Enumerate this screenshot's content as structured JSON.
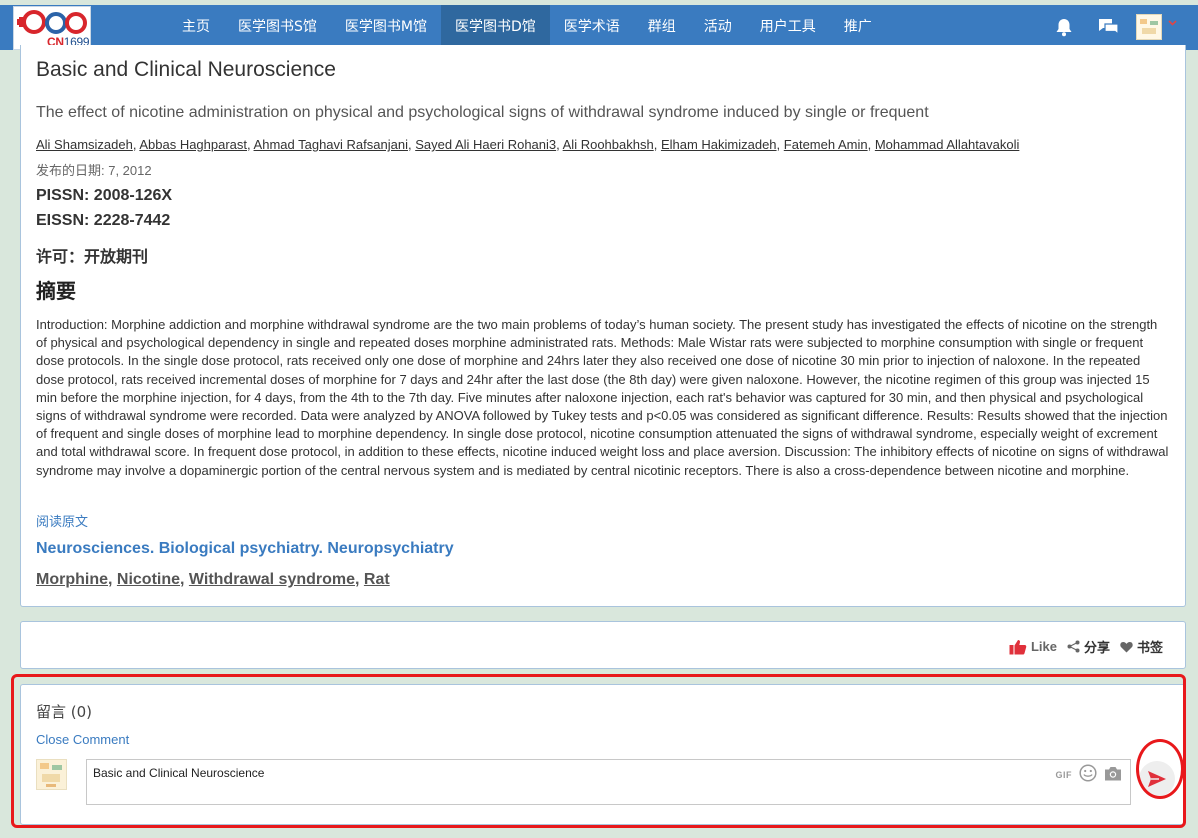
{
  "nav": {
    "logo_text": "CN",
    "logo_num": "1699",
    "items": [
      "主页",
      "医学图书S馆",
      "医学图书M馆",
      "医学图书D馆",
      "医学术语",
      "群组",
      "活动",
      "用户工具",
      "推广"
    ],
    "active_index": 3,
    "bell_icon": "bell-icon",
    "chat_icon": "chat-icon",
    "avatar_icon": "avatar",
    "caret_icon": "chevron-down-icon"
  },
  "article": {
    "journal": "Basic and Clinical Neuroscience",
    "title": "The effect of nicotine administration on physical and psychological signs of withdrawal syndrome induced by single or frequent",
    "authors": [
      "Ali Shamsizadeh",
      "Abbas Haghparast",
      "Ahmad Taghavi Rafsanjani",
      "Sayed Ali Haeri Rohani3",
      "Ali Roohbakhsh",
      "Elham Hakimizadeh",
      "Fatemeh Amin",
      "Mohammad Allahtavakoli"
    ],
    "pubdate": "发布的日期: 7, 2012",
    "pissn": "PISSN: 2008-126X",
    "eissn": "EISSN: 2228-7442",
    "license": "许可：开放期刊",
    "abstract_heading": "摘要",
    "abstract": "Introduction: Morphine addiction and morphine withdrawal syndrome are the two main problems of today’s human society. The present study has investigated the effects of nicotine on the strength of physical and psychological dependency in single and repeated doses morphine administrated rats. Methods: Male Wistar rats were subjected to morphine consumption with single or frequent dose protocols. In the single dose protocol, rats received only one dose of morphine and 24hrs later they also received one dose of nicotine 30 min prior to injection of naloxone. In the repeated dose protocol, rats received incremental doses of morphine for 7 days and 24hr after the last dose (the 8th day) were given naloxone. However, the nicotine regimen of this group was injected 15 min before the morphine injection, for 4 days, from the 4th to the 7th day. Five minutes after naloxone injection, each rat's behavior was captured for 30 min, and then physical and psychological signs of withdrawal syndrome were recorded. Data were analyzed by ANOVA followed by Tukey tests and p<0.05 was considered as significant difference. Results: Results showed that the injection of frequent and single doses of morphine lead to morphine dependency. In single dose protocol, nicotine consumption attenuated the signs of withdrawal syndrome, especially weight of excrement and total withdrawal score. In frequent dose protocol, in addition to these effects, nicotine induced weight loss and place aversion. Discussion: The inhibitory effects of nicotine on signs of withdrawal syndrome may involve a dopaminergic portion of the central nervous system and is mediated by central nicotinic receptors. There is also a cross-dependence between nicotine and morphine.",
    "read_original": "阅读原文",
    "subject": "Neurosciences. Biological psychiatry. Neuropsychiatry",
    "keywords": [
      "Morphine",
      "Nicotine",
      "Withdrawal syndrome",
      "Rat"
    ]
  },
  "actions": {
    "like": "Like",
    "share": "分享",
    "bookmark": "书签"
  },
  "comments": {
    "title": "留言 (0)",
    "close_label": "Close Comment",
    "input_value": "Basic and Clinical Neuroscience",
    "gif_label": "GIF"
  },
  "colors": {
    "nav_bg": "#3a7bc0",
    "nav_active": "#2f689f",
    "link_blue": "#3a7bc0",
    "highlight_red": "#e8181b",
    "like_red": "#e0303b"
  }
}
